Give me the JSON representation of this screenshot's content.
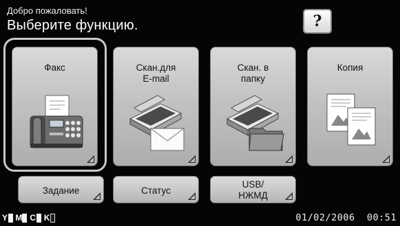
{
  "header": {
    "welcome": "Добро пожаловать!",
    "prompt": "Выберите функцию.",
    "help_label": "?"
  },
  "functions": [
    {
      "label": "Факс",
      "icon": "fax-icon"
    },
    {
      "label": "Скан.для\nE-mail",
      "icon": "scan-to-email-icon"
    },
    {
      "label": "Скан. в\nпапку",
      "icon": "scan-to-folder-icon"
    },
    {
      "label": "Копия",
      "icon": "copy-icon"
    }
  ],
  "selected_function": "Факс",
  "bottom_buttons": [
    {
      "label": "Задание"
    },
    {
      "label": "Статус"
    },
    {
      "label": "USB/\nНЖМД"
    }
  ],
  "toner": [
    {
      "label": "Y"
    },
    {
      "label": "M"
    },
    {
      "label": "C"
    },
    {
      "label": "K"
    }
  ],
  "datetime": "01/02/2006  00:51"
}
